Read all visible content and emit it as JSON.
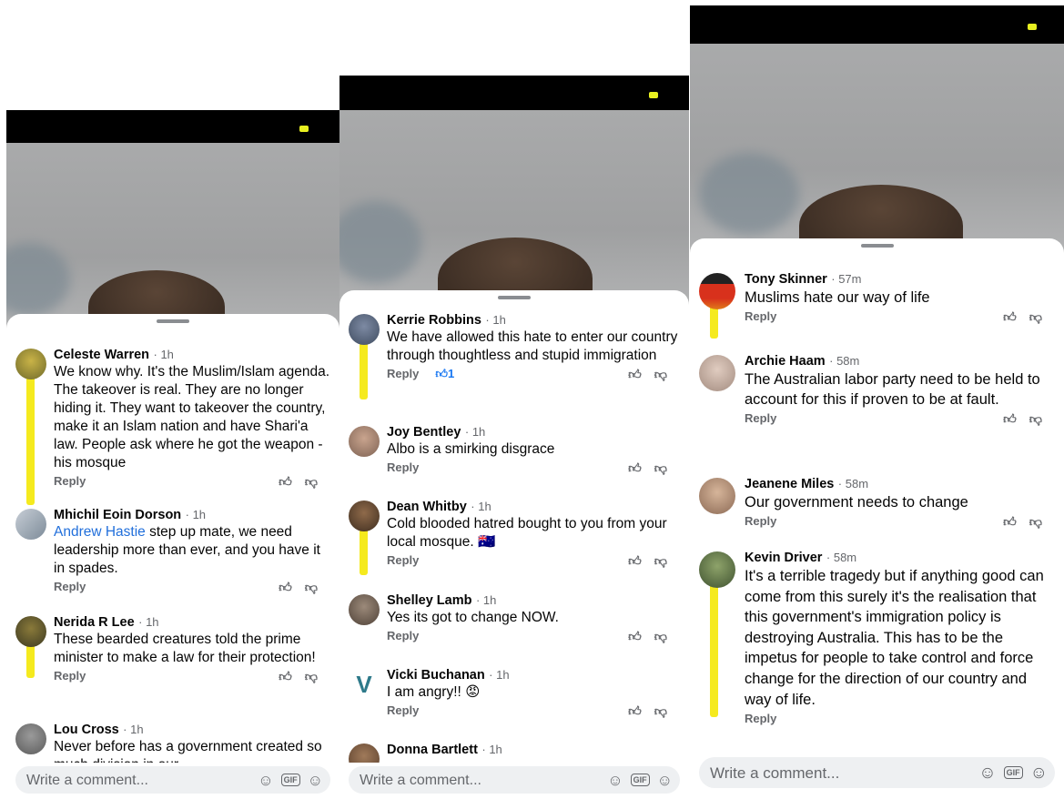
{
  "panels": [
    {
      "comments": [
        {
          "name": "Celeste Warren",
          "time": "1h",
          "text": "We know why. It's the Muslim/Islam agenda. The takeover is real. They are no longer hiding it. They want to takeover the country, make it an Islam nation and have Shari'a law. People ask where he got the weapon - his mosque",
          "reply": "Reply"
        },
        {
          "name": "Mhichil Eoin Dorson",
          "time": "1h",
          "mention": "Andrew Hastie",
          "text": " step up mate, we need leadership more than ever, and you have it in spades.",
          "reply": "Reply"
        },
        {
          "name": "Nerida R Lee",
          "time": "1h",
          "text": "These bearded creatures told the prime minister to make a law for their protection!",
          "reply": "Reply"
        },
        {
          "name": "Lou Cross",
          "time": "1h",
          "text": "Never before has a government created so much division in our",
          "reply": ""
        }
      ],
      "placeholder": "Write a comment..."
    },
    {
      "comments": [
        {
          "name": "Kerrie Robbins",
          "time": "1h",
          "text": "We have allowed this hate to enter our country through thoughtless and stupid immigration",
          "reply": "Reply",
          "reaction_count": "1"
        },
        {
          "name": "Joy Bentley",
          "time": "1h",
          "text": "Albo is a smirking disgrace",
          "reply": "Reply"
        },
        {
          "name": "Dean Whitby",
          "time": "1h",
          "text": "Cold blooded hatred bought to you from your local mosque. 🇦🇺",
          "reply": "Reply"
        },
        {
          "name": "Shelley Lamb",
          "time": "1h",
          "text": "Yes its got to change NOW.",
          "reply": "Reply"
        },
        {
          "name": "Vicki Buchanan",
          "time": "1h",
          "text": "I am angry!! 😡",
          "reply": "Reply"
        },
        {
          "name": "Donna Bartlett",
          "time": "1h",
          "text": "",
          "reply": ""
        }
      ],
      "placeholder": "Write a comment..."
    },
    {
      "comments": [
        {
          "name": "Tony Skinner",
          "time": "57m",
          "text": "Muslims hate our way of life",
          "reply": "Reply"
        },
        {
          "name": "Archie Haam",
          "time": "58m",
          "text": "The Australian labor party need to be held to account for this if proven to be at fault.",
          "reply": "Reply"
        },
        {
          "name": "Jeanene Miles",
          "time": "58m",
          "text": "Our government needs to change",
          "reply": "Reply"
        },
        {
          "name": "Kevin Driver",
          "time": "58m",
          "text": "It's a terrible tragedy but if anything good can come from this surely it's the realisation that this government's immigration policy is destroying Australia. This has to be the impetus for people to take control and force change for the direction of our country and way of life.",
          "reply": "Reply"
        }
      ],
      "placeholder": "Write a comment..."
    }
  ],
  "icons": {
    "like": "thumbs-up-icon",
    "dislike": "thumbs-down-icon",
    "sticker": "sticker-icon",
    "gif": "GIF",
    "emoji": "emoji-icon"
  },
  "colors": {
    "highlight": "#f5ea1e",
    "link": "#216fdb",
    "status_dot": "#e8f020"
  }
}
